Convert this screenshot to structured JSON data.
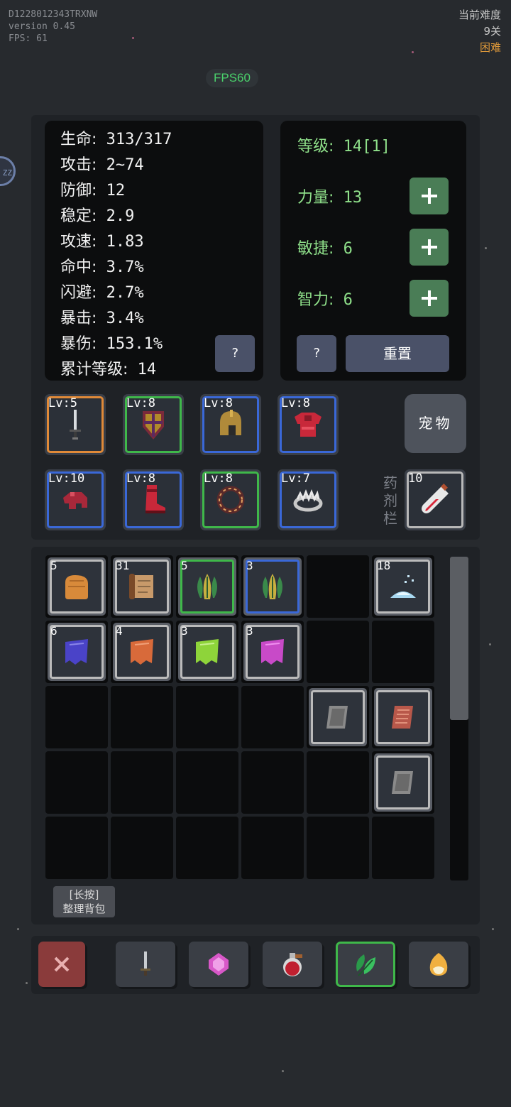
{
  "debug": {
    "build_id": "D1228012343TRXNW",
    "version": "version 0.45",
    "fps": "FPS: 61"
  },
  "difficulty": {
    "label": "当前难度",
    "stage": "9关",
    "level": "困难"
  },
  "fps_badge": "FPS60",
  "bubble_text": "ZZ",
  "stats": [
    {
      "key": "生命:",
      "value": "313/317"
    },
    {
      "key": "攻击:",
      "value": "2~74"
    },
    {
      "key": "防御:",
      "value": "12"
    },
    {
      "key": "稳定:",
      "value": "2.9"
    },
    {
      "key": "攻速:",
      "value": "1.83"
    },
    {
      "key": "命中:",
      "value": "3.7%"
    },
    {
      "key": "闪避:",
      "value": "2.7%"
    },
    {
      "key": "暴击:",
      "value": "3.4%"
    },
    {
      "key": "暴伤:",
      "value": "153.1%"
    },
    {
      "key": "累计等级:",
      "value": "14"
    }
  ],
  "stats_help": "?",
  "attributes": {
    "level": {
      "key": "等级:",
      "value": "14[1]"
    },
    "strength": {
      "key": "力量:",
      "value": "13"
    },
    "agility": {
      "key": "敏捷:",
      "value": "6"
    },
    "intelligence": {
      "key": "智力:",
      "value": "6"
    },
    "help": "?",
    "reset": "重置"
  },
  "equipment": [
    {
      "lv": "Lv:5",
      "icon": "sword-icon",
      "rarity": "orange"
    },
    {
      "lv": "Lv:8",
      "icon": "shield-icon",
      "rarity": "green"
    },
    {
      "lv": "Lv:8",
      "icon": "helmet-icon",
      "rarity": "blue"
    },
    {
      "lv": "Lv:8",
      "icon": "armor-icon",
      "rarity": "blue"
    },
    {
      "lv": "Lv:10",
      "icon": "gloves-icon",
      "rarity": "blue"
    },
    {
      "lv": "Lv:8",
      "icon": "boots-icon",
      "rarity": "blue"
    },
    {
      "lv": "Lv:8",
      "icon": "ring-icon",
      "rarity": "green"
    },
    {
      "lv": "Lv:7",
      "icon": "crown-icon",
      "rarity": "blue"
    }
  ],
  "pet_button": "宠物",
  "potion_label": "药剂栏",
  "potion_slot": {
    "count": "10",
    "icon": "potion-vial-icon"
  },
  "bag": [
    {
      "count": "5",
      "icon": "bread-icon",
      "rarity": "gray"
    },
    {
      "count": "31",
      "icon": "scroll-icon",
      "rarity": "gray"
    },
    {
      "count": "5",
      "icon": "herb-icon",
      "rarity": "green"
    },
    {
      "count": "3",
      "icon": "herb-icon",
      "rarity": "blue"
    },
    {
      "count": "18",
      "icon": "crystal-dust-icon",
      "rarity": "gray"
    },
    {
      "count": "6",
      "icon": "cloth-icon",
      "rarity": "gray",
      "color": "#4a43c8"
    },
    {
      "count": "4",
      "icon": "cloth-icon",
      "rarity": "gray",
      "color": "#d86a3a"
    },
    {
      "count": "3",
      "icon": "cloth-icon",
      "rarity": "gray",
      "color": "#8ed43a"
    },
    {
      "count": "3",
      "icon": "cloth-icon",
      "rarity": "gray",
      "color": "#c84ac8"
    },
    {
      "count": "",
      "icon": "stone-tablet-icon",
      "rarity": "gray"
    },
    {
      "count": "",
      "icon": "copper-tablet-icon",
      "rarity": "gray"
    },
    {
      "count": "",
      "icon": "stone-tablet-icon",
      "rarity": "gray"
    }
  ],
  "sort_button": {
    "line1": "[长按]",
    "line2": "整理背包"
  },
  "toolbar": [
    "close-icon",
    "sword-icon",
    "gem-icon",
    "potion-icon",
    "leaf-icon",
    "egg-icon"
  ],
  "colors": {
    "orange": "#e08a38",
    "green": "#3fb84a",
    "blue": "#3a68d8",
    "gray": "#b8b8b8",
    "hard": "#e09a3a"
  }
}
